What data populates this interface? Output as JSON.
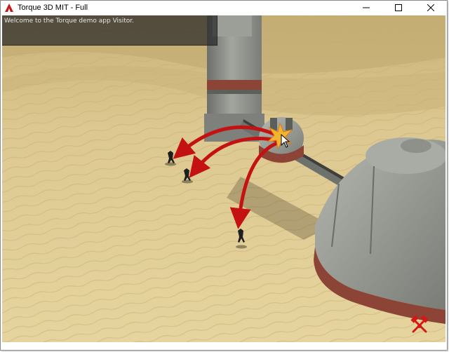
{
  "window": {
    "title": "Torque 3D MIT - Full",
    "app_icon": "torque-logo-icon",
    "controls": [
      "minimize-icon",
      "maximize-icon",
      "close-icon"
    ]
  },
  "console": {
    "message": "Welcome to the Torque demo app Visitor."
  },
  "scene": {
    "description_icons": [
      "red-arrow-icon",
      "impact-burst-icon",
      "mouse-cursor-icon",
      "crossed-hammers-icon"
    ],
    "colors": {
      "sand": "#d9c48a",
      "sand_dark": "#b89f63",
      "tower": "#8d8f8a",
      "tower_stripe": "#8c4436",
      "arrow": "#c41212",
      "burst": "#f2b52f",
      "hud_icon": "#d41818"
    }
  }
}
